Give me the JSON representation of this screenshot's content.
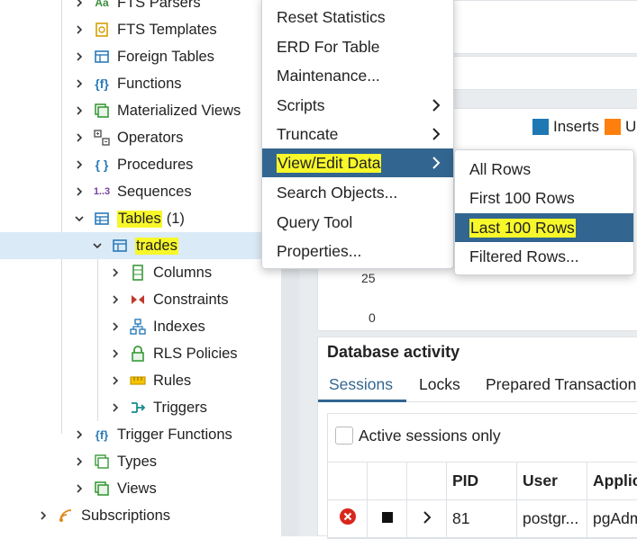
{
  "tree": {
    "items": [
      {
        "label": "FTS Parsers",
        "icon": "fts-parsers-icon"
      },
      {
        "label": "FTS Templates",
        "icon": "fts-templates-icon"
      },
      {
        "label": "Foreign Tables",
        "icon": "foreign-tables-icon"
      },
      {
        "label": "Functions",
        "icon": "functions-icon"
      },
      {
        "label": "Materialized Views",
        "icon": "materialized-views-icon"
      },
      {
        "label": "Operators",
        "icon": "operators-icon"
      },
      {
        "label": "Procedures",
        "icon": "procedures-icon"
      },
      {
        "label": "Sequences",
        "icon": "sequences-icon",
        "icon_text": "1..3"
      },
      {
        "label": "Tables",
        "count": "(1)",
        "icon": "tables-icon"
      },
      {
        "label": "trades",
        "icon": "table-icon"
      },
      {
        "label": "Columns",
        "icon": "columns-icon"
      },
      {
        "label": "Constraints",
        "icon": "constraints-icon"
      },
      {
        "label": "Indexes",
        "icon": "indexes-icon"
      },
      {
        "label": "RLS Policies",
        "icon": "rls-policies-icon"
      },
      {
        "label": "Rules",
        "icon": "rules-icon"
      },
      {
        "label": "Triggers",
        "icon": "triggers-icon"
      },
      {
        "label": "Trigger Functions",
        "icon": "trigger-functions-icon"
      },
      {
        "label": "Types",
        "icon": "types-icon"
      },
      {
        "label": "Views",
        "icon": "views-icon"
      },
      {
        "label": "Subscriptions",
        "icon": "subscriptions-icon"
      }
    ]
  },
  "context_menu": {
    "items": [
      {
        "label": "Reset Statistics"
      },
      {
        "label": "ERD For Table"
      },
      {
        "label": "Maintenance..."
      },
      {
        "label": "Scripts",
        "has_submenu": true
      },
      {
        "label": "Truncate",
        "has_submenu": true
      },
      {
        "label": "View/Edit Data",
        "has_submenu": true,
        "active": true
      },
      {
        "label": "Search Objects..."
      },
      {
        "label": "Query Tool"
      },
      {
        "label": "Properties..."
      }
    ]
  },
  "submenu": {
    "items": [
      {
        "label": "All Rows"
      },
      {
        "label": "First 100 Rows"
      },
      {
        "label": "Last 100 Rows",
        "active": true
      },
      {
        "label": "Filtered Rows..."
      }
    ]
  },
  "chart": {
    "legend": [
      {
        "label": "Inserts",
        "color": "#1f77b4"
      },
      {
        "label": "Upd",
        "color": "#ff7f0e"
      }
    ],
    "y_ticks": [
      "25",
      "0"
    ]
  },
  "activity": {
    "title": "Database activity",
    "tabs": [
      "Sessions",
      "Locks",
      "Prepared Transaction"
    ],
    "active_tab": "Sessions",
    "filter_label": "Active sessions only",
    "columns": [
      "PID",
      "User",
      "Applic"
    ],
    "rows": [
      {
        "pid": "81",
        "user": "postgr...",
        "application": "pgAdm"
      }
    ]
  },
  "colors": {
    "accent": "#326690",
    "highlight": "#f7f72a",
    "selection": "#dbeaf7"
  }
}
